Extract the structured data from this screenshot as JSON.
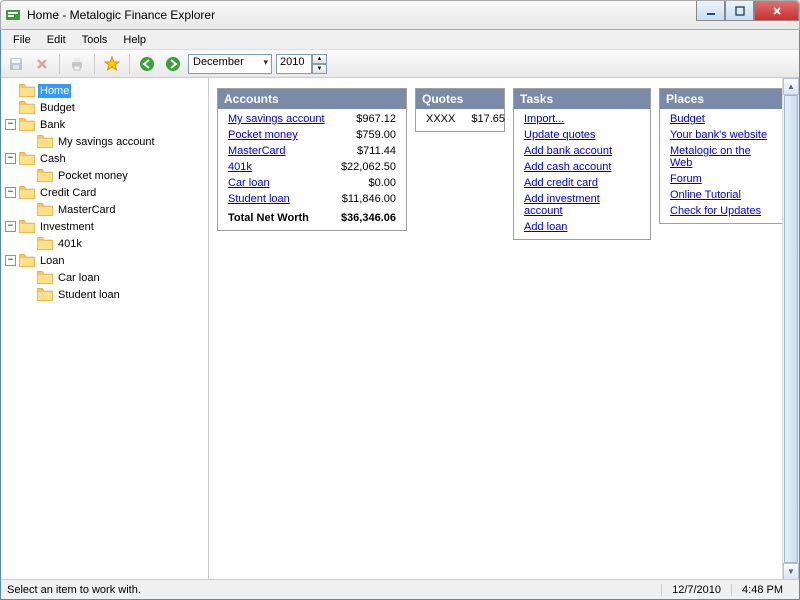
{
  "window": {
    "title": "Home - Metalogic Finance Explorer"
  },
  "menubar": {
    "items": [
      "File",
      "Edit",
      "Tools",
      "Help"
    ]
  },
  "toolbar": {
    "month": "December",
    "year": "2010"
  },
  "tree": [
    {
      "depth": 0,
      "expander": "none",
      "label": "Home",
      "selected": true
    },
    {
      "depth": 0,
      "expander": "none",
      "label": "Budget"
    },
    {
      "depth": 0,
      "expander": "minus",
      "label": "Bank"
    },
    {
      "depth": 1,
      "expander": "none",
      "label": "My savings account"
    },
    {
      "depth": 0,
      "expander": "minus",
      "label": "Cash"
    },
    {
      "depth": 1,
      "expander": "none",
      "label": "Pocket money"
    },
    {
      "depth": 0,
      "expander": "minus",
      "label": "Credit Card"
    },
    {
      "depth": 1,
      "expander": "none",
      "label": "MasterCard"
    },
    {
      "depth": 0,
      "expander": "minus",
      "label": "Investment"
    },
    {
      "depth": 1,
      "expander": "none",
      "label": "401k"
    },
    {
      "depth": 0,
      "expander": "minus",
      "label": "Loan"
    },
    {
      "depth": 1,
      "expander": "none",
      "label": "Car loan"
    },
    {
      "depth": 1,
      "expander": "none",
      "label": "Student loan"
    }
  ],
  "panels": {
    "accounts": {
      "title": "Accounts",
      "rows": [
        {
          "name": "My savings account",
          "amount": "$967.12"
        },
        {
          "name": "Pocket money",
          "amount": "$759.00"
        },
        {
          "name": "MasterCard",
          "amount": "$711.44"
        },
        {
          "name": "401k",
          "amount": "$22,062.50"
        },
        {
          "name": "Car loan",
          "amount": "$0.00"
        },
        {
          "name": "Student loan",
          "amount": "$11,846.00"
        }
      ],
      "total_label": "Total Net Worth",
      "total_amount": "$36,346.06"
    },
    "quotes": {
      "title": "Quotes",
      "rows": [
        {
          "name": "XXXX",
          "amount": "$17.65"
        }
      ]
    },
    "tasks": {
      "title": "Tasks",
      "items": [
        "Import...",
        "Update quotes",
        "Add bank account",
        "Add cash account",
        "Add credit card",
        "Add investment account",
        "Add loan"
      ]
    },
    "places": {
      "title": "Places",
      "items": [
        "Budget",
        "Your bank's website",
        "Metalogic on the Web",
        "Forum",
        "Online Tutorial",
        "Check for Updates"
      ]
    }
  },
  "statusbar": {
    "text": "Select an item to work with.",
    "date": "12/7/2010",
    "time": "4:48 PM"
  }
}
